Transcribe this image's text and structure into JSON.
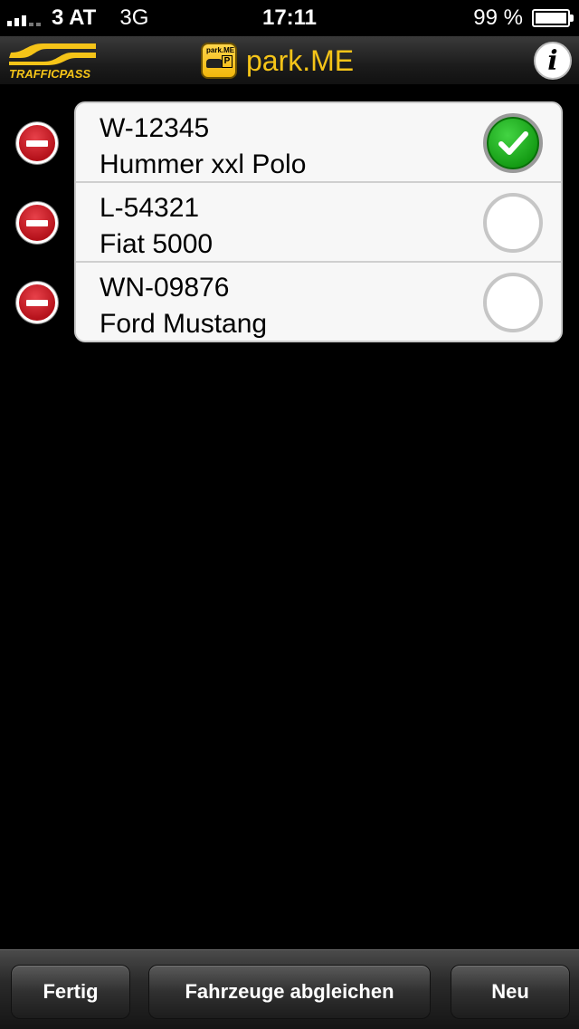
{
  "status_bar": {
    "carrier": "3 AT",
    "network": "3G",
    "time": "17:11",
    "battery": "99 %",
    "battery_level": 0.99
  },
  "nav_bar": {
    "logo_text": "TRAFFICPASS",
    "app_title": "park.ME",
    "app_icon_label": "park.ME",
    "info_icon": "info-icon"
  },
  "vehicles": [
    {
      "plate": "W-12345",
      "model": "Hummer xxl Polo",
      "selected": true
    },
    {
      "plate": "L-54321",
      "model": "Fiat 5000",
      "selected": false
    },
    {
      "plate": "WN-09876",
      "model": "Ford Mustang",
      "selected": false
    }
  ],
  "toolbar": {
    "done_label": "Fertig",
    "sync_label": "Fahrzeuge abgleichen",
    "new_label": "Neu"
  },
  "colors": {
    "accent": "#f5c418",
    "delete": "#c8161f",
    "check": "#1fae1f"
  }
}
